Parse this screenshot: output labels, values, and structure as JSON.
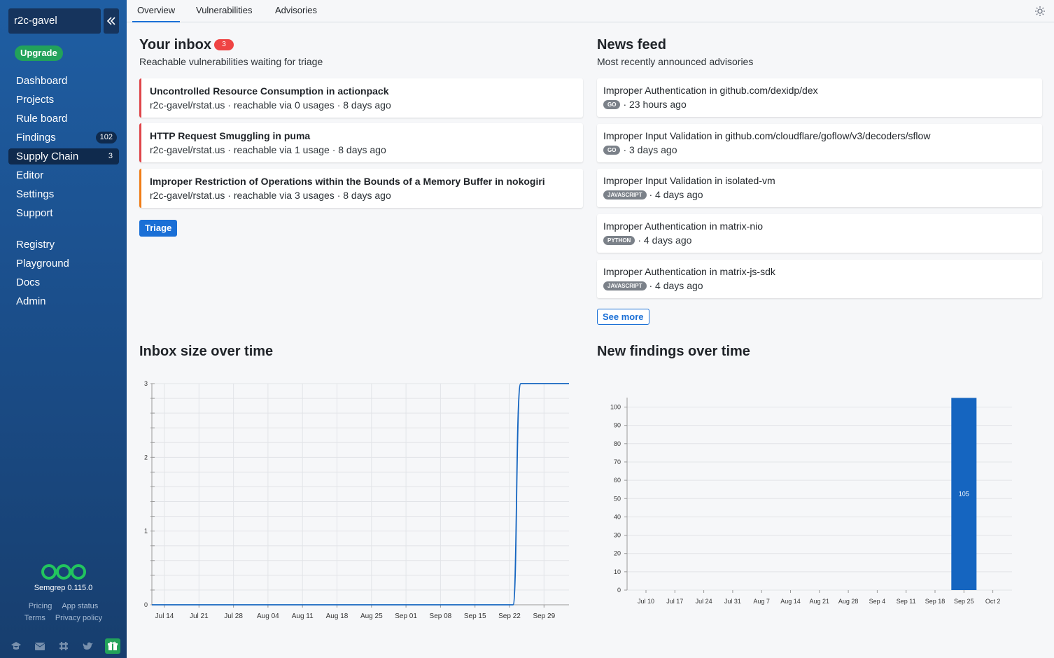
{
  "sidebar": {
    "org": "r2c-gavel",
    "upgrade_label": "Upgrade",
    "nav": [
      {
        "label": "Dashboard",
        "badge": ""
      },
      {
        "label": "Projects",
        "badge": ""
      },
      {
        "label": "Rule board",
        "badge": ""
      },
      {
        "label": "Findings",
        "badge": "102"
      },
      {
        "label": "Supply Chain",
        "badge": "3",
        "active": true
      },
      {
        "label": "Editor",
        "badge": ""
      },
      {
        "label": "Settings",
        "badge": ""
      },
      {
        "label": "Support",
        "badge": ""
      }
    ],
    "nav2": [
      {
        "label": "Registry"
      },
      {
        "label": "Playground"
      },
      {
        "label": "Docs"
      },
      {
        "label": "Admin"
      }
    ],
    "version": "Semgrep 0.115.0",
    "footer_links": [
      "Pricing",
      "App status",
      "Terms",
      "Privacy policy"
    ],
    "social_icons": [
      "graduation-cap-icon",
      "mail-icon",
      "slack-icon",
      "twitter-icon",
      "gift-icon"
    ]
  },
  "tabs": [
    {
      "label": "Overview",
      "active": true
    },
    {
      "label": "Vulnerabilities"
    },
    {
      "label": "Advisories"
    }
  ],
  "inbox": {
    "title": "Your inbox",
    "count": "3",
    "subtitle": "Reachable vulnerabilities waiting for triage",
    "items": [
      {
        "title": "Uncontrolled Resource Consumption in actionpack",
        "meta": "r2c-gavel/rstat.us · reachable via 0 usages · 8 days ago",
        "severity": "high"
      },
      {
        "title": "HTTP Request Smuggling in puma",
        "meta": "r2c-gavel/rstat.us · reachable via 1 usage · 8 days ago",
        "severity": "high"
      },
      {
        "title": "Improper Restriction of Operations within the Bounds of a Memory Buffer in nokogiri",
        "meta": "r2c-gavel/rstat.us · reachable via 3 usages · 8 days ago",
        "severity": "medium"
      }
    ],
    "triage_label": "Triage"
  },
  "news": {
    "title": "News feed",
    "subtitle": "Most recently announced advisories",
    "items": [
      {
        "title": "Improper Authentication in github.com/dexidp/dex",
        "lang": "GO",
        "time": "· 23 hours ago"
      },
      {
        "title": "Improper Input Validation in github.com/cloudflare/goflow/v3/decoders/sflow",
        "lang": "GO",
        "time": "· 3 days ago"
      },
      {
        "title": "Improper Input Validation in isolated-vm",
        "lang": "JAVASCRIPT",
        "time": "· 4 days ago"
      },
      {
        "title": "Improper Authentication in matrix-nio",
        "lang": "PYTHON",
        "time": "· 4 days ago"
      },
      {
        "title": "Improper Authentication in matrix-js-sdk",
        "lang": "JAVASCRIPT",
        "time": "· 4 days ago"
      }
    ],
    "see_more_label": "See more"
  },
  "chart_data": [
    {
      "type": "line",
      "title": "Inbox size over time",
      "x": [
        "Jul 14",
        "Jul 21",
        "Jul 28",
        "Aug 04",
        "Aug 11",
        "Aug 18",
        "Aug 25",
        "Sep 01",
        "Sep 08",
        "Sep 15",
        "Sep 22",
        "Sep 29"
      ],
      "series": [
        {
          "points": [
            [
              "Jul 12",
              0
            ],
            [
              "Sep 23",
              0
            ],
            [
              "Sep 24",
              3
            ],
            [
              "Oct 2",
              3
            ]
          ]
        }
      ],
      "yticks": [
        0,
        1,
        2,
        3
      ],
      "ylim": [
        0,
        3
      ],
      "color": "#1565c0",
      "grid": true
    },
    {
      "type": "bar",
      "title": "New findings over time",
      "categories": [
        "Jul 10",
        "Jul 17",
        "Jul 24",
        "Jul 31",
        "Aug 7",
        "Aug 14",
        "Aug 21",
        "Aug 28",
        "Sep 4",
        "Sep 11",
        "Sep 18",
        "Sep 25",
        "Oct 2"
      ],
      "values": [
        0,
        0,
        0,
        0,
        0,
        0,
        0,
        0,
        0,
        0,
        0,
        105,
        0
      ],
      "yticks": [
        0,
        10,
        20,
        30,
        40,
        50,
        60,
        70,
        80,
        90,
        100
      ],
      "ylim": [
        0,
        105
      ],
      "color": "#1565c0",
      "grid": true
    }
  ]
}
